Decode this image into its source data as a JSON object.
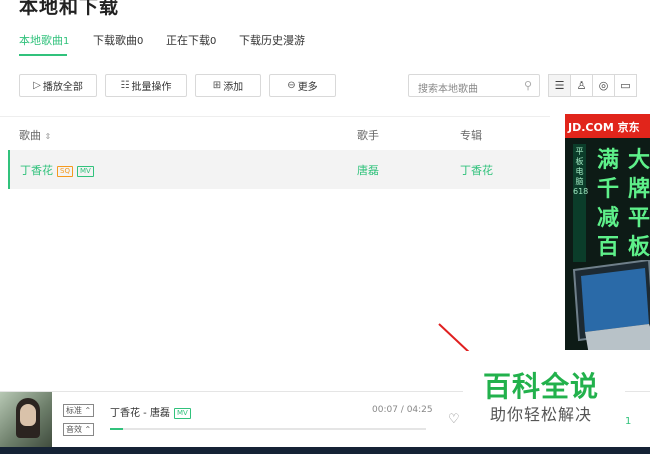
{
  "page": {
    "title": "本地和下载"
  },
  "tabs": [
    {
      "label": "本地歌曲",
      "count": "1",
      "active": true
    },
    {
      "label": "下载歌曲",
      "count": "0"
    },
    {
      "label": "正在下载",
      "count": "0"
    },
    {
      "label": "下载历史漫游",
      "count": ""
    }
  ],
  "toolbar": {
    "play_all": "播放全部",
    "batch": "批量操作",
    "add": "添加",
    "more": "更多"
  },
  "search": {
    "placeholder": "搜索本地歌曲"
  },
  "view_buttons": [
    "list-view-icon",
    "singer-view-icon",
    "album-view-icon",
    "folder-view-icon"
  ],
  "table": {
    "headers": {
      "song": "歌曲",
      "singer": "歌手",
      "album": "专辑"
    },
    "rows": [
      {
        "song": "丁香花",
        "sq": "SQ",
        "mv": "MV",
        "singer": "唐磊",
        "album": "丁香花"
      }
    ]
  },
  "ad": {
    "brand": "JD.COM 京东",
    "side_text": "平板电脑618",
    "col1": "满千减百",
    "col2": "大牌平板"
  },
  "player": {
    "quality": "标准",
    "effect": "音效",
    "now_playing": "丁香花 - 唐磊",
    "mv": "MV",
    "time": "00:07 / 04:25",
    "progress": 0.04,
    "playlist_count": "1"
  },
  "watermark": {
    "title": "百科全说",
    "subtitle": "助你轻松解决"
  },
  "colors": {
    "accent": "#31c27c",
    "sq_tag": "#f49a1f",
    "ad_red": "#e1251b",
    "ad_green": "#5ef08a"
  }
}
